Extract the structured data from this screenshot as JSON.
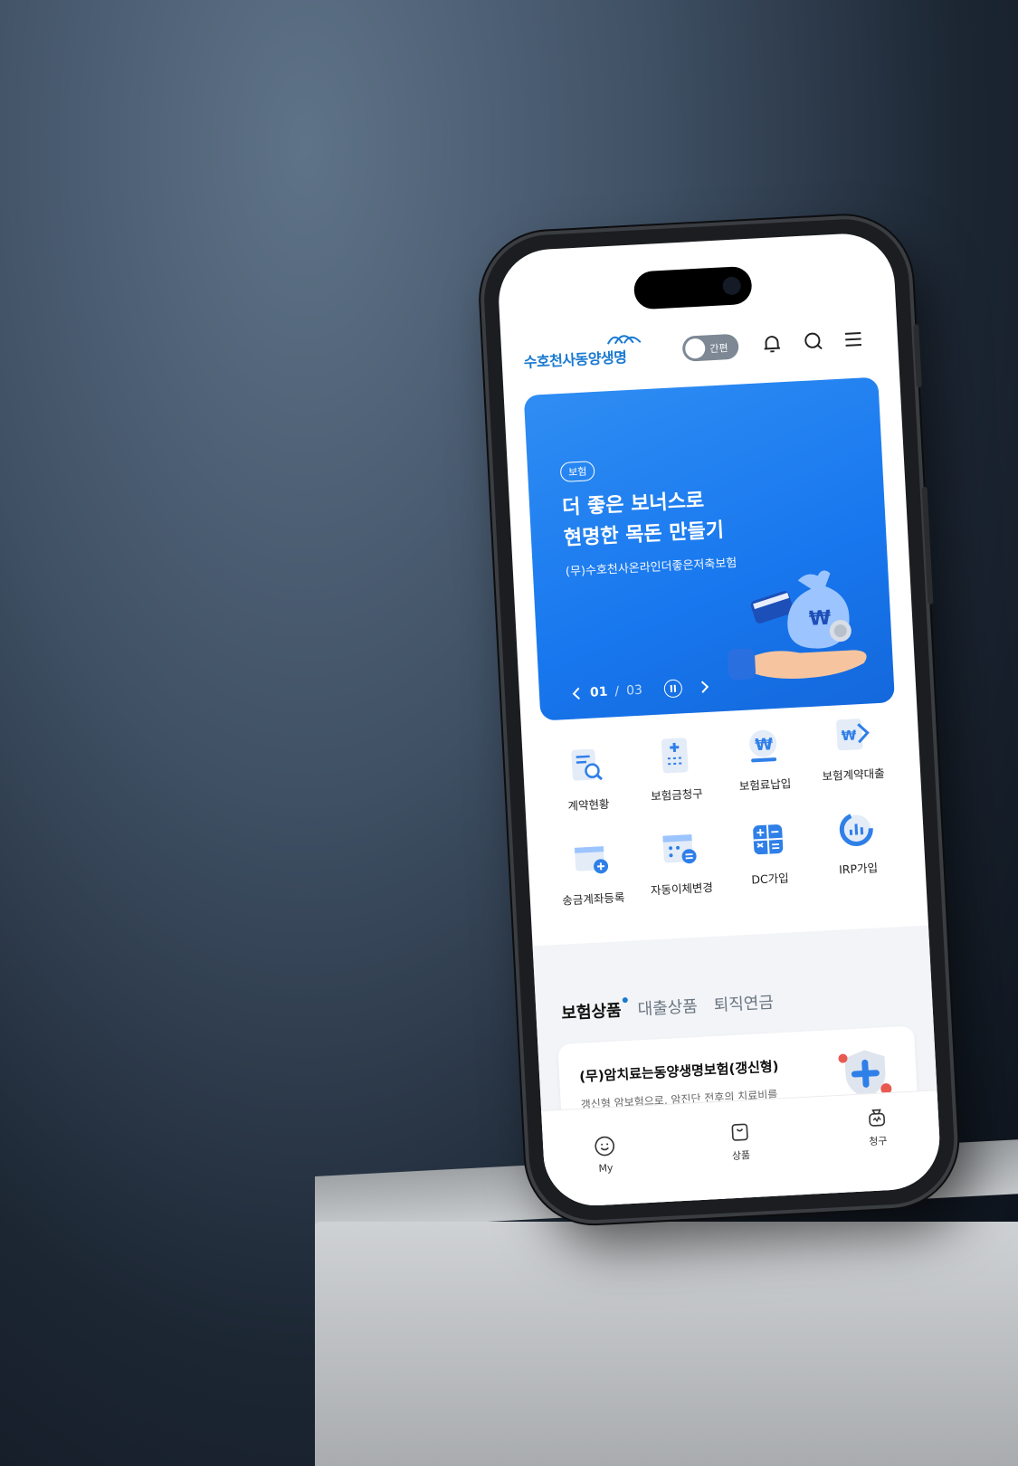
{
  "app": {
    "logo_text": "수호천사동양생명",
    "toggle_label": "간편"
  },
  "banner": {
    "tag": "보험",
    "title_line1": "더 좋은 보너스로",
    "title_line2": "현명한 목돈 만들기",
    "subtitle": "(무)수호천사온라인더좋은저축보험",
    "page_current": "01",
    "page_separator": "/",
    "page_total": "03"
  },
  "menu": {
    "items": [
      {
        "label": "계약현황",
        "icon": "contract-search-icon"
      },
      {
        "label": "보험금청구",
        "icon": "claim-document-icon"
      },
      {
        "label": "보험료납입",
        "icon": "won-payment-icon"
      },
      {
        "label": "보험계약대출",
        "icon": "loan-document-icon"
      },
      {
        "label": "송금계좌등록",
        "icon": "account-add-icon"
      },
      {
        "label": "자동이체변경",
        "icon": "auto-transfer-icon"
      },
      {
        "label": "DC가입",
        "icon": "calculator-icon"
      },
      {
        "label": "IRP가입",
        "icon": "chart-ring-icon"
      }
    ]
  },
  "products": {
    "tabs": [
      "보험상품",
      "대출상품",
      "퇴직연금"
    ],
    "card_title": "(무)암치료는동양생명보험(갱신형)",
    "card_desc": "갱신형 암보험으로, 암진단 전후의 치료비를 특약으로 보장해요"
  },
  "bottom_nav": [
    {
      "label": "My",
      "icon": "smile-icon"
    },
    {
      "label": "상품",
      "icon": "shopping-bag-icon"
    },
    {
      "label": "청구",
      "icon": "claim-bag-icon"
    }
  ],
  "colors": {
    "brand_blue": "#1a7ad1",
    "banner_blue": "#1877ee",
    "section_bg": "#f2f4f7"
  }
}
